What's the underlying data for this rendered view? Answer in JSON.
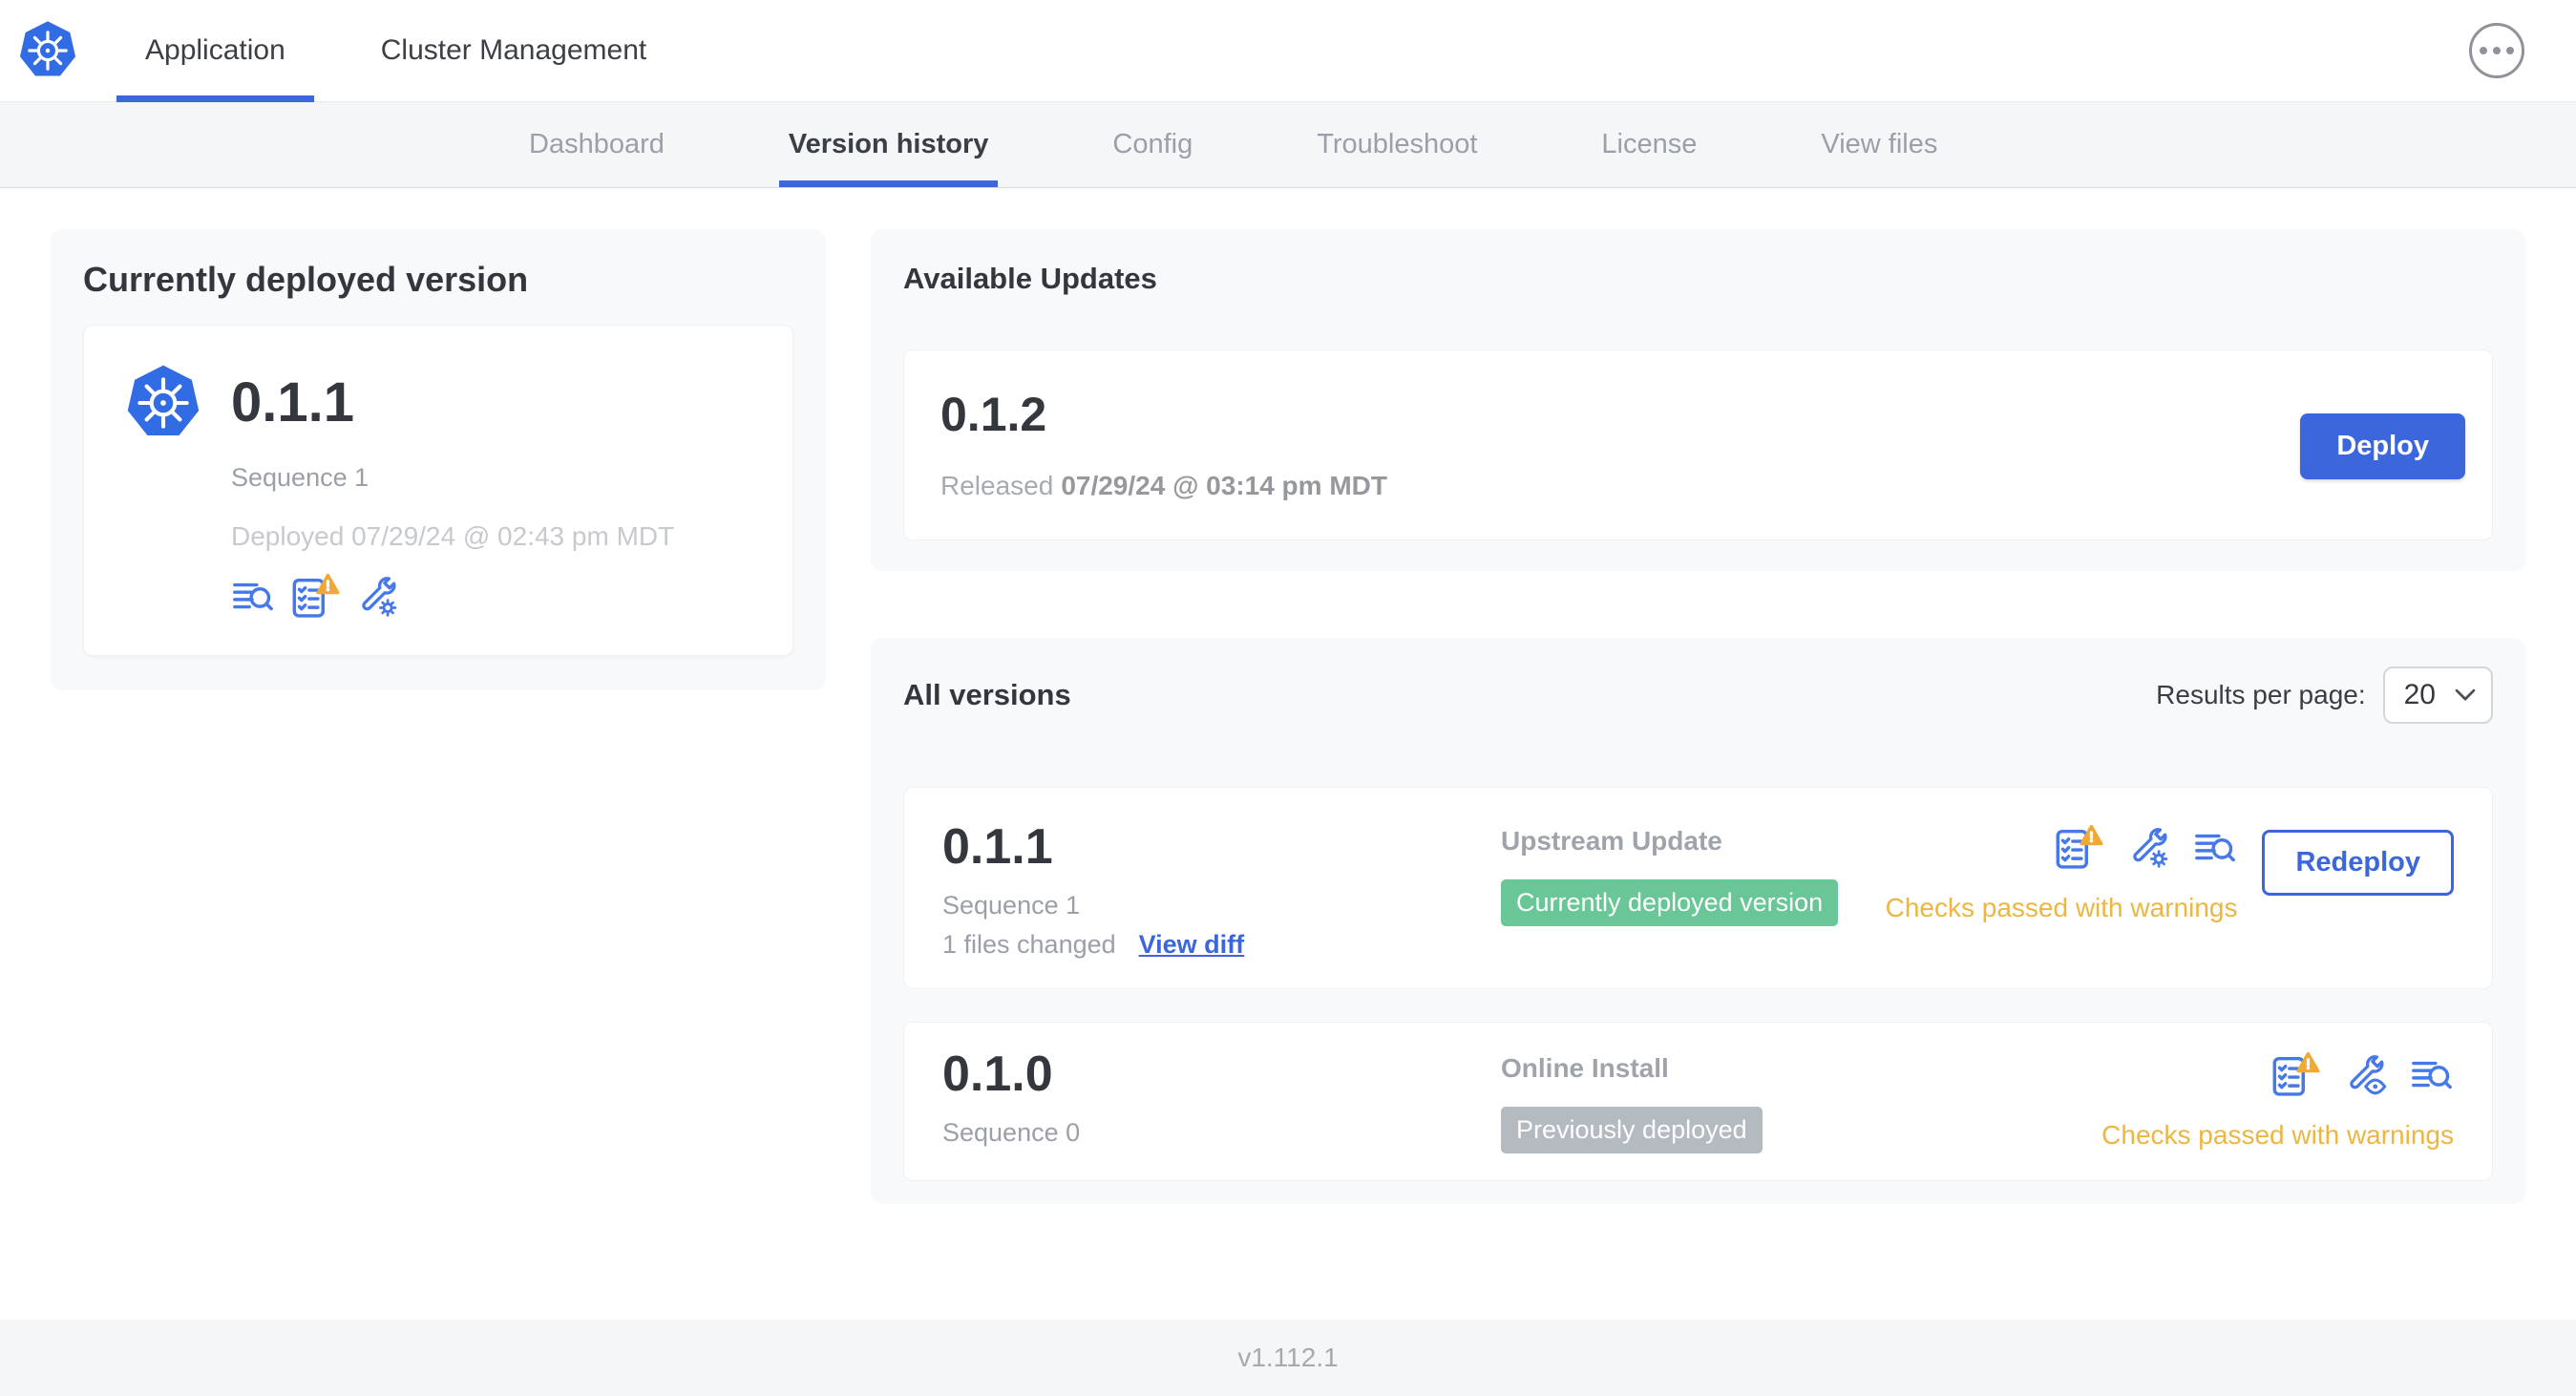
{
  "topbar": {
    "tabs": [
      {
        "label": "Application",
        "active": true
      },
      {
        "label": "Cluster Management",
        "active": false
      }
    ]
  },
  "subnav": {
    "tabs": [
      "Dashboard",
      "Version history",
      "Config",
      "Troubleshoot",
      "License",
      "View files"
    ],
    "active": "Version history"
  },
  "current": {
    "title": "Currently deployed version",
    "version": "0.1.1",
    "sequence": "Sequence 1",
    "deployed": "Deployed 07/29/24 @ 02:43 pm MDT",
    "icons": [
      "deploy-logs-icon",
      "preflight-checks-warning-icon",
      "edit-config-icon"
    ]
  },
  "available": {
    "title": "Available Updates",
    "version": "0.1.2",
    "released_label": "Released",
    "released_date": "07/29/24 @ 03:14 pm MDT",
    "deploy_label": "Deploy"
  },
  "allv": {
    "title": "All versions",
    "results_label": "Results per page:",
    "results_value": "20",
    "rows": [
      {
        "version": "0.1.1",
        "sequence": "Sequence 1",
        "files_changed": "1 files changed",
        "view_diff_label": "View diff",
        "source": "Upstream Update",
        "badge": "Currently deployed version",
        "badge_color": "green",
        "icons": [
          "preflight-checks-warning-icon",
          "edit-config-icon",
          "deploy-logs-icon"
        ],
        "status": "Checks passed with warnings",
        "action_label": "Redeploy"
      },
      {
        "version": "0.1.0",
        "sequence": "Sequence 0",
        "source": "Online Install",
        "badge": "Previously deployed",
        "badge_color": "gray",
        "icons": [
          "preflight-checks-warning-icon",
          "view-config-icon",
          "deploy-logs-icon"
        ],
        "status": "Checks passed with warnings"
      }
    ]
  },
  "footer": {
    "version": "v1.112.1"
  },
  "colors": {
    "accent_blue": "#3b66dc",
    "icon_blue": "#4678e8",
    "k8s_blue": "#326ce5",
    "badge_green": "#69c697",
    "badge_gray": "#b3bac0",
    "warning_orange": "#ecb640",
    "warning_triangle": "#f0a935",
    "panel_gray": "#f8f9fb",
    "nav_gray": "#f5f6f8"
  }
}
